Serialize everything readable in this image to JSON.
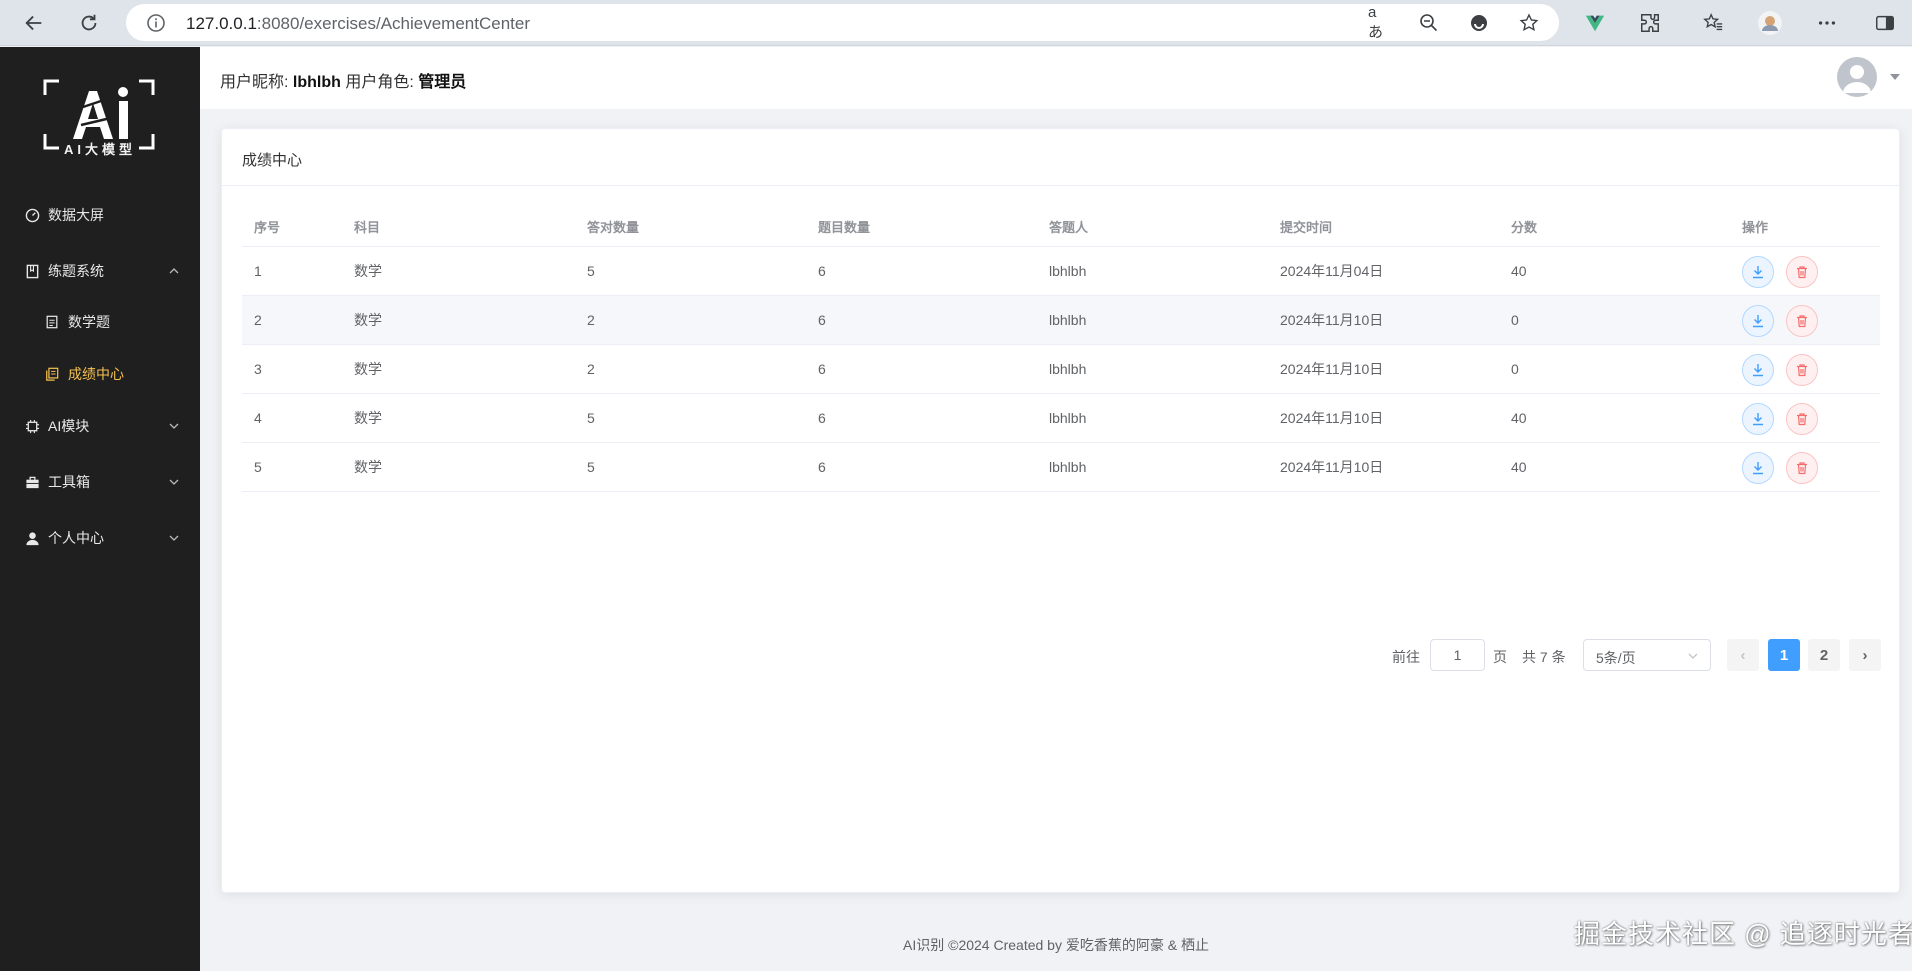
{
  "browser": {
    "url_host": "127.0.0.1",
    "url_rest": ":8080/exercises/AchievementCenter"
  },
  "sidebar": {
    "logo_text": "AI大模型",
    "items": [
      {
        "label": "数据大屏"
      },
      {
        "label": "练题系统"
      },
      {
        "label": "数学题"
      },
      {
        "label": "成绩中心"
      },
      {
        "label": "AI模块"
      },
      {
        "label": "工具箱"
      },
      {
        "label": "个人中心"
      }
    ]
  },
  "header": {
    "nickname_label": "用户昵称:",
    "nickname": "lbhlbh",
    "role_label": "用户角色:",
    "role": "管理员"
  },
  "card": {
    "title": "成绩中心",
    "columns": [
      "序号",
      "科目",
      "答对数量",
      "题目数量",
      "答题人",
      "提交时间",
      "分数",
      "操作"
    ],
    "rows": [
      [
        "1",
        "数学",
        "5",
        "6",
        "lbhlbh",
        "2024年11月04日",
        "40"
      ],
      [
        "2",
        "数学",
        "2",
        "6",
        "lbhlbh",
        "2024年11月10日",
        "0"
      ],
      [
        "3",
        "数学",
        "2",
        "6",
        "lbhlbh",
        "2024年11月10日",
        "0"
      ],
      [
        "4",
        "数学",
        "5",
        "6",
        "lbhlbh",
        "2024年11月10日",
        "40"
      ],
      [
        "5",
        "数学",
        "5",
        "6",
        "lbhlbh",
        "2024年11月10日",
        "40"
      ]
    ]
  },
  "pagination": {
    "goto_label": "前往",
    "goto_value": "1",
    "page_suffix": "页",
    "total_text": "共 7 条",
    "page_size": "5条/页",
    "pages": [
      "1",
      "2"
    ],
    "current_page": "1",
    "prev_icon": "‹",
    "next_icon": "›"
  },
  "footer": {
    "text": "AI识别 ©2024 Created by 爱吃香蕉的阿豪 & 栖止"
  },
  "watermark": "掘金技术社区 @ 追逐时光者",
  "colors": {
    "sidebar_bg": "#1f1f1f",
    "active_menu": "#f5c04f",
    "primary": "#409eff",
    "danger": "#f56c6c"
  }
}
